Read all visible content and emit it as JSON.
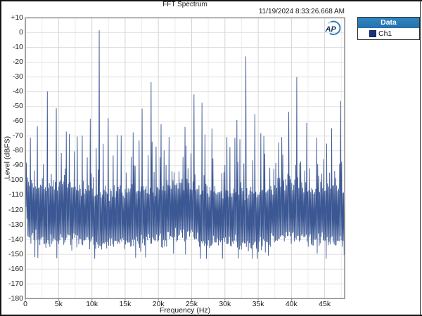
{
  "header": {
    "title": "FFT Spectrum",
    "timestamp": "11/19/2024 8:33:26.668 AM"
  },
  "legend": {
    "header": "Data",
    "entries": [
      {
        "label": "Ch1",
        "swatch_color": "#17317d"
      }
    ]
  },
  "logo": {
    "name": "AP",
    "text": "AP"
  },
  "colors": {
    "trace": "#3c5894",
    "grid_h": "#e0e0e0",
    "grid_v_major": "#d6d6d6",
    "grid_v_minor": "#ececec",
    "plot_border": "#848484",
    "legend_header_bg": "#2979b7",
    "frame": "#141414"
  },
  "chart_data": {
    "type": "line",
    "title": "FFT Spectrum",
    "xlabel": "Frequency (Hz)",
    "ylabel": "Level (dBFS)",
    "xlim": [
      0,
      48000
    ],
    "ylim": [
      -180,
      10
    ],
    "x_tick_step": 5000,
    "x_tick_labels": [
      "0",
      "5k",
      "10k",
      "15k",
      "20k",
      "25k",
      "30k",
      "35k",
      "40k",
      "45k"
    ],
    "y_tick_step": 10,
    "y_tick_labels": [
      "+10",
      "0",
      "-10",
      "-20",
      "-30",
      "-40",
      "-50",
      "-60",
      "-70",
      "-80",
      "-90",
      "-100",
      "-110",
      "-120",
      "-130",
      "-140",
      "-150",
      "-160",
      "-170",
      "-180"
    ],
    "grid_minor_x_step": 2500,
    "legend_position": "top-right-outside",
    "series_name": "Ch1",
    "major_peaks_hz_dbfs": [
      [
        700,
        -71
      ],
      [
        1800,
        -63.4
      ],
      [
        3240,
        -39.8
      ],
      [
        4560,
        -51.2
      ],
      [
        6040,
        -67.0
      ],
      [
        8540,
        -69.7
      ],
      [
        9740,
        -58.2
      ],
      [
        11000,
        1.6
      ],
      [
        12400,
        -57.9
      ],
      [
        13800,
        -69.3
      ],
      [
        16200,
        -67.5
      ],
      [
        17500,
        -51.4
      ],
      [
        18900,
        -33.5
      ],
      [
        20300,
        -62.0
      ],
      [
        21600,
        -70.6
      ],
      [
        24000,
        -63.8
      ],
      [
        25300,
        -41.8
      ],
      [
        26500,
        -47.4
      ],
      [
        28000,
        -64.9
      ],
      [
        30300,
        -70.7
      ],
      [
        31800,
        -59.2
      ],
      [
        33100,
        -16.1
      ],
      [
        34400,
        -55.1
      ],
      [
        35800,
        -69.9
      ],
      [
        38500,
        -70.7
      ],
      [
        39500,
        -53.6
      ],
      [
        40800,
        -30.1
      ],
      [
        42200,
        -61.0
      ],
      [
        43700,
        -71.0
      ],
      [
        46000,
        -64.7
      ],
      [
        47300,
        -46.2
      ]
    ],
    "noise_floor": {
      "description": "dense FFT noise floor; column tops ~-95..-115 dBFS, bottoms ~-128..-152 dBFS",
      "bins": 640,
      "top_mean": -106,
      "top_spread": 7,
      "bottom_mean": -141,
      "bottom_spread": 6,
      "spike_comb_hz": 655,
      "spike_top_range": [
        -96,
        -68
      ],
      "min_level": -153,
      "max_floor_level": -75,
      "dc_level": -70,
      "seed": 20241119
    }
  },
  "axes_text": {
    "x_title": "Frequency (Hz)",
    "y_title": "Level (dBFS)"
  }
}
